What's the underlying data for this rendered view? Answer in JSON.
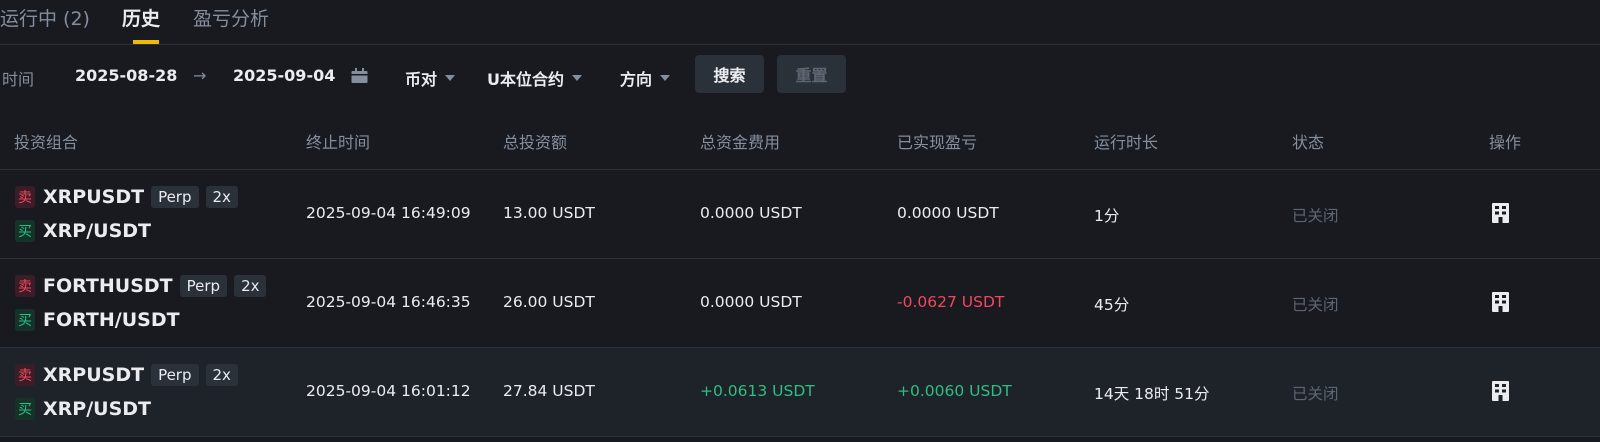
{
  "tabs": {
    "running": "运行中 (2)",
    "history": "历史",
    "pnl": "盈亏分析"
  },
  "filters": {
    "time_label": "时间",
    "start_date": "2025-08-28",
    "arrow": "→",
    "end_date": "2025-09-04",
    "calendar_icon": "calendar-icon",
    "pair_label": "币对",
    "contract_label": "U本位合约",
    "direction_label": "方向",
    "search_label": "搜索",
    "reset_label": "重置"
  },
  "table": {
    "headers": [
      "投资组合",
      "终止时间",
      "总投资额",
      "总资金费用",
      "已实现盈亏",
      "运行时长",
      "状态",
      "操作"
    ],
    "side_sell": "卖",
    "side_buy": "买",
    "rows": [
      {
        "perp_symbol": "XRPUSDT",
        "perp_tag": "Perp",
        "leverage": "2x",
        "spot_symbol": "XRP/USDT",
        "end_time": "2025-09-04 16:49:09",
        "total_investment": "13.00 USDT",
        "funding_fee": "0.0000 USDT",
        "realized_pnl": "0.0000 USDT",
        "duration": "1分",
        "status": "已关闭"
      },
      {
        "perp_symbol": "FORTHUSDT",
        "perp_tag": "Perp",
        "leverage": "2x",
        "spot_symbol": "FORTH/USDT",
        "end_time": "2025-09-04 16:46:35",
        "total_investment": "26.00 USDT",
        "funding_fee": "0.0000 USDT",
        "realized_pnl": "-0.0627 USDT",
        "duration": "45分",
        "status": "已关闭"
      },
      {
        "perp_symbol": "XRPUSDT",
        "perp_tag": "Perp",
        "leverage": "2x",
        "spot_symbol": "XRP/USDT",
        "end_time": "2025-09-04 16:01:12",
        "total_investment": "27.84 USDT",
        "funding_fee": "+0.0613 USDT",
        "realized_pnl": "+0.0060 USDT",
        "duration": "14天 18时 51分",
        "status": "已关闭"
      }
    ],
    "action_icon": "details-icon"
  },
  "colors": {
    "background": "#181a20",
    "accent": "#f0b90b",
    "negative": "#f6465d",
    "positive": "#2ebd85",
    "muted": "#848e9c"
  }
}
